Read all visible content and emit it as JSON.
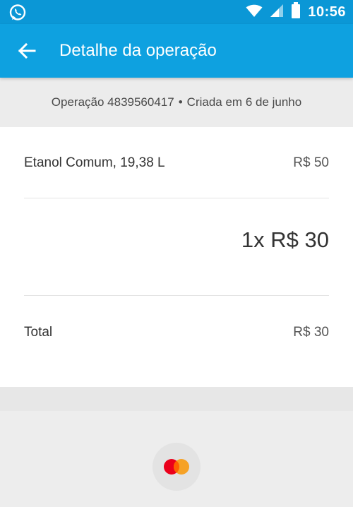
{
  "status_bar": {
    "time": "10:56",
    "icons": [
      "whatsapp-icon",
      "wifi-icon",
      "signal-icon",
      "battery-icon"
    ]
  },
  "toolbar": {
    "back_icon": "arrow-left-icon",
    "title": "Detalhe da operação"
  },
  "operation": {
    "id_text": "Operação 4839560417",
    "separator": "•",
    "created_text": "Criada em 6 de junho"
  },
  "details": {
    "item_label": "Etanol Comum, 19,38 L",
    "item_amount": "R$ 50",
    "installments": "1x R$ 30",
    "total_label": "Total",
    "total_amount": "R$ 30"
  },
  "payment": {
    "card_icon": "mastercard-icon"
  },
  "colors": {
    "status_bar": "#0b97d6",
    "toolbar": "#0ea1e0",
    "mastercard_red": "#eb001b",
    "mastercard_orange": "#f79e1b"
  }
}
